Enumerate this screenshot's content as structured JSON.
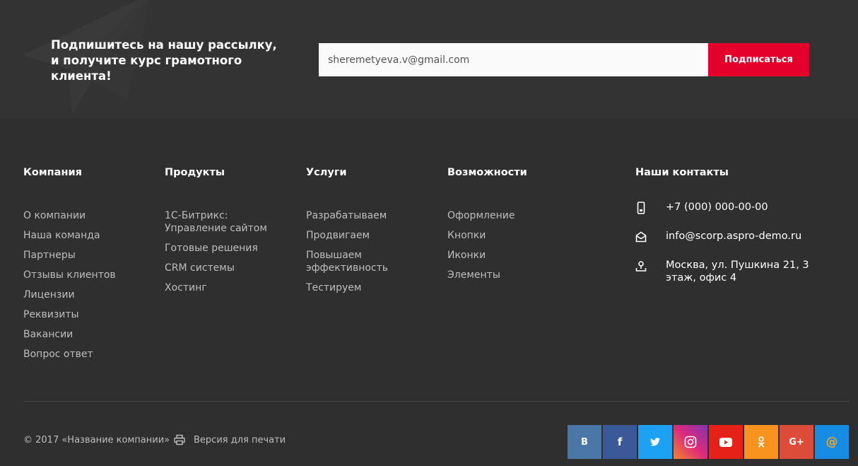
{
  "subscribe": {
    "title": "Подпишитесь на нашу рассылку, и получите курс грамотного клиента!",
    "input_value": "sheremetyeva.v@gmail.com",
    "button_label": "Подписаться"
  },
  "columns": [
    {
      "title": "Компания",
      "items": [
        "О компании",
        "Наша команда",
        "Партнеры",
        "Отзывы клиентов",
        "Лицензии",
        "Реквизиты",
        "Вакансии",
        "Вопрос ответ"
      ]
    },
    {
      "title": "Продукты",
      "items": [
        "1С-Битрикс: Управление сайтом",
        "Готовые решения",
        "CRM системы",
        "Хостинг"
      ]
    },
    {
      "title": "Услуги",
      "items": [
        "Разрабатываем",
        "Продвигаем",
        "Повышаем эффективность",
        "Тестируем"
      ]
    },
    {
      "title": "Возможности",
      "items": [
        "Оформление",
        "Кнопки",
        "Иконки",
        "Элементы"
      ]
    }
  ],
  "contacts": {
    "title": "Наши контакты",
    "phone": "+7 (000) 000-00-00",
    "email": "info@scorp.aspro-demo.ru",
    "address": "Москва, ул. Пушкина 21, 3 этаж, офис 4"
  },
  "bottom": {
    "copyright": "© 2017 «Название компании»",
    "print_label": "Версия для печати"
  },
  "socials": [
    {
      "name": "vk",
      "label": "В",
      "color": "#4a76a8"
    },
    {
      "name": "facebook",
      "label": "f",
      "color": "#3b5998"
    },
    {
      "name": "twitter",
      "label": "",
      "color": "#1da1f2"
    },
    {
      "name": "instagram",
      "label": "",
      "color": "#8a3ab9"
    },
    {
      "name": "youtube",
      "label": "",
      "color": "#e62117"
    },
    {
      "name": "odnoklassniki",
      "label": "",
      "color": "#f7931e"
    },
    {
      "name": "google-plus",
      "label": "G+",
      "color": "#dd4b39"
    },
    {
      "name": "mail",
      "label": "@",
      "color": "#168de2"
    }
  ],
  "colors": {
    "accent": "#e4002b",
    "background": "#2f2f2f",
    "band": "#333333"
  }
}
